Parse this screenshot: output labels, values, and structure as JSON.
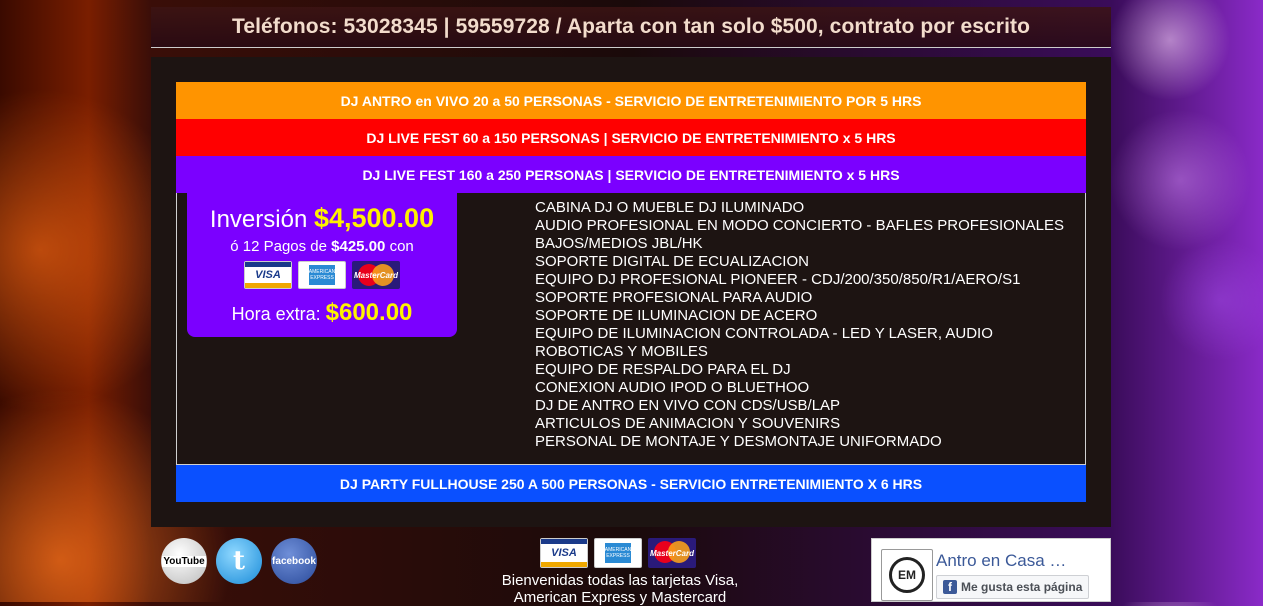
{
  "header": {
    "phones_text": "Teléfonos: 53028345 | 59559728 / Aparta con tan solo $500, contrato por escrito"
  },
  "packages": [
    {
      "label": "DJ ANTRO en VIVO 20 a 50 PERSONAS - SERVICIO DE ENTRETENIMIENTO POR 5 HRS",
      "color": "#ff9400"
    },
    {
      "label": "DJ LIVE FEST 60 a 150 PERSONAS | SERVICIO DE ENTRETENIMIENTO x 5 HRS",
      "color": "#ff0000"
    },
    {
      "label": "DJ LIVE FEST 160 a 250 PERSONAS | SERVICIO DE ENTRETENIMIENTO x 5 HRS",
      "color": "#7b00ff"
    },
    {
      "label": "DJ PARTY FULLHOUSE 250 A 500 PERSONAS - SERVICIO ENTRETENIMIENTO X 6 HRS",
      "color": "#0a50ff"
    }
  ],
  "price": {
    "inversion_label": "Inversión",
    "inversion_amount": "$4,500.00",
    "pagos_prefix": "ó 12 Pagos de",
    "pagos_amount": "$425.00",
    "pagos_suffix": "con",
    "extra_label": "Hora extra:",
    "extra_amount": "$600.00"
  },
  "cards": {
    "visa": "VISA",
    "amex": "AMERICAN EXPRESS",
    "mastercard": "MasterCard"
  },
  "features": [
    "CABINA DJ O MUEBLE DJ ILUMINADO",
    "AUDIO PROFESIONAL EN MODO CONCIERTO - BAFLES PROFESIONALES",
    "BAJOS/MEDIOS JBL/HK",
    "SOPORTE DIGITAL DE ECUALIZACION",
    "EQUIPO DJ PROFESIONAL PIONEER - CDJ/200/350/850/R1/AERO/S1",
    "SOPORTE PROFESIONAL PARA AUDIO",
    "SOPORTE DE ILUMINACION DE ACERO",
    "EQUIPO DE ILUMINACION CONTROLADA - LED Y LASER, AUDIO",
    "ROBOTICAS Y MOBILES",
    "EQUIPO DE RESPALDO PARA EL DJ",
    "CONEXION AUDIO IPOD O BLUETHOO",
    "DJ DE ANTRO EN VIVO CON CDS/USB/LAP",
    "ARTICULOS DE ANIMACION Y SOUVENIRS",
    "PERSONAL DE MONTAJE Y DESMONTAJE UNIFORMADO"
  ],
  "social": {
    "youtube": "YouTube",
    "twitter": "t",
    "facebook": "facebook"
  },
  "footer": {
    "welcome_line1": "Bienvenidas todas las tarjetas Visa,",
    "welcome_line2": "American Express y Mastercard"
  },
  "fb_widget": {
    "page_name": "Antro en Casa …",
    "logo_text": "EM",
    "like_label": "Me gusta esta página"
  }
}
